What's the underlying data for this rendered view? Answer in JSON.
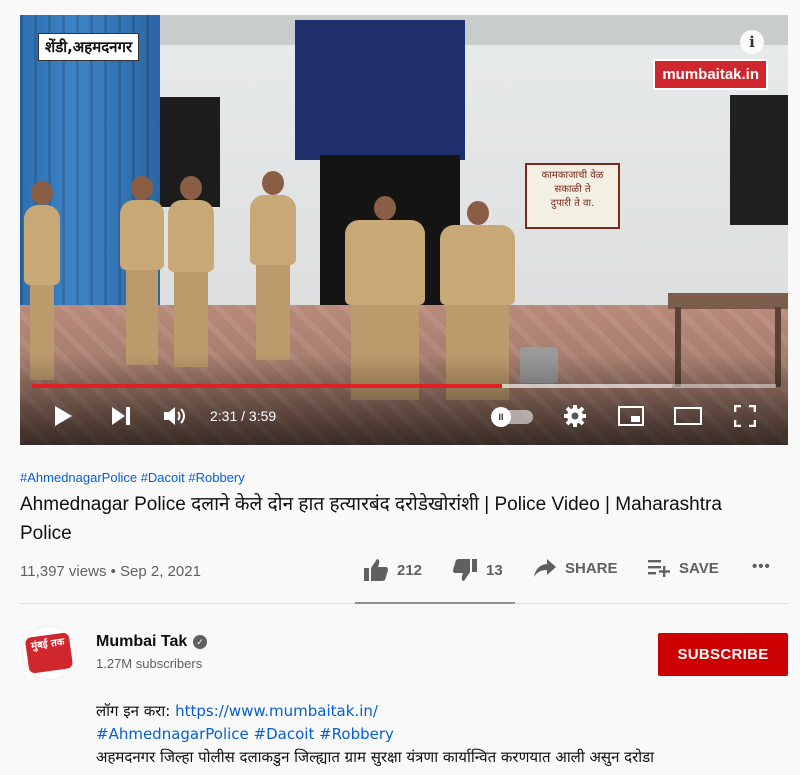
{
  "video": {
    "location_label": "शेंडी,अहमदनगर",
    "brand_watermark": "mumbaitak.in",
    "info_icon_glyph": "i",
    "sign_text": [
      "कामकाजाची वेळ",
      "सकाळी ते",
      "दुपारी ते वा."
    ],
    "time_display": "2:31 / 3:59",
    "progress_fraction": 0.632,
    "loaded_fraction": 0.86,
    "autoplay_glyph": "II",
    "controls": [
      "play-icon",
      "next-icon",
      "volume-icon",
      "settings-icon",
      "miniplayer-icon",
      "theater-icon",
      "fullscreen-icon"
    ],
    "progress_color": "#e02020"
  },
  "meta": {
    "hashtags": "#AhmednagarPolice #Dacoit #Robbery",
    "title": "Ahmednagar Police दलाने केले दोन हात हत्यारबंद दरोडेखोरांशी | Police Video | Maharashtra Police",
    "views_date": "11,397 views • Sep 2, 2021",
    "likes": "212",
    "dislikes": "13",
    "share_label": "SHARE",
    "save_label": "SAVE",
    "more_label": "•••"
  },
  "channel": {
    "name": "Mumbai Tak",
    "subscribers": "1.27M subscribers",
    "avatar_text": "मुंबई तक",
    "subscribe_label": "SUBSCRIBE",
    "accent_color": "#cc0000"
  },
  "description": {
    "line1_prefix": "लॉग इन करा: ",
    "line1_link": "https://www.mumbaitak.in/",
    "line2": "#AhmednagarPolice #Dacoit #Robbery",
    "line3": "अहमदनगर जिल्हा पोलीस दलाकडुन जिल्ह्यात ग्राम सुरक्षा यंत्रणा कार्यान्वित करणयात आली असुन दरोडा"
  }
}
